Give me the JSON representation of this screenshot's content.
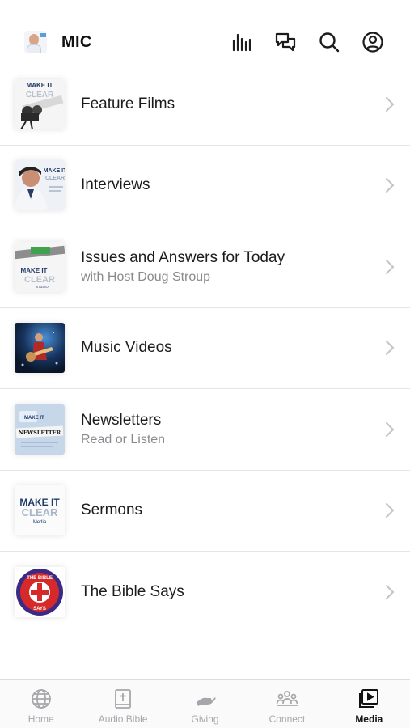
{
  "header": {
    "title": "MIC",
    "actions": [
      {
        "icon": "audio-bars-icon"
      },
      {
        "icon": "chat-icon"
      },
      {
        "icon": "search-icon"
      },
      {
        "icon": "profile-icon"
      }
    ]
  },
  "list": {
    "items": [
      {
        "title": "Feature Films",
        "subtitle": "",
        "thumb_icon": "film-camera-thumbnail"
      },
      {
        "title": "Interviews",
        "subtitle": "",
        "thumb_icon": "interview-portrait-thumbnail"
      },
      {
        "title": "Issues and Answers for Today",
        "subtitle": "with Host Doug Stroup",
        "thumb_icon": "issues-answers-thumbnail"
      },
      {
        "title": "Music Videos",
        "subtitle": "",
        "thumb_icon": "guitarist-thumbnail"
      },
      {
        "title": "Newsletters",
        "subtitle": "Read or Listen",
        "thumb_icon": "newsletter-thumbnail"
      },
      {
        "title": "Sermons",
        "subtitle": "",
        "thumb_icon": "make-it-clear-logo-thumbnail"
      },
      {
        "title": "The Bible Says",
        "subtitle": "",
        "thumb_icon": "bible-says-badge-thumbnail"
      }
    ],
    "thumb_text": {
      "make_it": "MAKE IT",
      "clear": "CLEAR",
      "studio": "STUDIO",
      "media": "Media",
      "newsletter": "NEWSLETTER",
      "the_bible": "THE BIBLE",
      "says": "SAYS"
    }
  },
  "tabbar": {
    "tabs": [
      {
        "label": "Home",
        "icon": "globe-icon",
        "active": false
      },
      {
        "label": "Audio Bible",
        "icon": "bible-book-icon",
        "active": false
      },
      {
        "label": "Giving",
        "icon": "giving-hand-icon",
        "active": false
      },
      {
        "label": "Connect",
        "icon": "people-group-icon",
        "active": false
      },
      {
        "label": "Media",
        "icon": "media-play-icon",
        "active": true
      }
    ]
  },
  "colors": {
    "text": "#1c1c1e",
    "subtext": "#8a8a8e",
    "divider": "#e6e6e8",
    "tab_inactive": "#a7a7ab",
    "tab_active": "#111111",
    "brand_navy": "#1f3a68"
  }
}
